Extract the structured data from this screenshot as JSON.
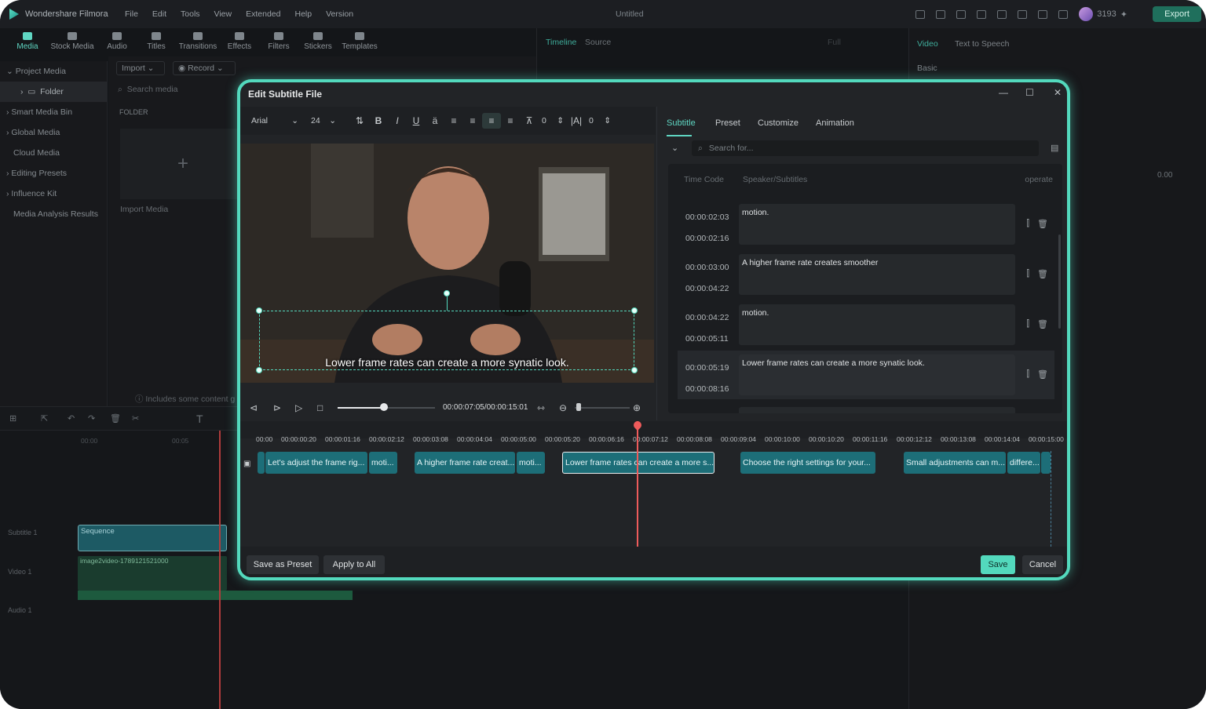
{
  "app": {
    "name": "Wondershare Filmora",
    "project_title": "Untitled",
    "menu": [
      "File",
      "Edit",
      "Tools",
      "View",
      "Extended",
      "Help",
      "Version"
    ],
    "credits": "3193",
    "export_label": "Export"
  },
  "toolbar": [
    "Media",
    "Stock Media",
    "Audio",
    "Titles",
    "Transitions",
    "Effects",
    "Filters",
    "Stickers",
    "Templates"
  ],
  "left_nav": [
    "Project Media",
    "Folder",
    "Smart Media Bin",
    "Global Media",
    "Cloud Media",
    "Editing Presets",
    "Influence Kit",
    "Media Analysis Results"
  ],
  "media": {
    "import": "Import",
    "record": "Record",
    "search_placeholder": "Search media",
    "folder_header": "FOLDER",
    "import_media": "Import Media",
    "note": "Includes some content g"
  },
  "player_tabs": {
    "timeline": "Timeline",
    "source": "Source",
    "quality": "Full"
  },
  "right_panel": {
    "tabs": [
      "Video",
      "Text to Speech"
    ],
    "section": "Basic",
    "value": "0.00"
  },
  "timeline": {
    "ruler": [
      "00:00",
      "00:05"
    ],
    "tracks": [
      "Subtitle 1",
      "Video 1",
      "Audio 1"
    ],
    "sequence_clip": "Sequence",
    "video_clip": "image2video-1789121521000"
  },
  "dialog": {
    "title": "Edit Subtitle File",
    "font": "Arial",
    "size": "24",
    "spacing": "0",
    "line_spacing": "0",
    "preview_subtitle": "Lower frame rates can create a more synatic look.",
    "timecode": "00:00:07:05/00:00:15:01",
    "tabs": [
      "Subtitle",
      "Preset",
      "Customize",
      "Animation"
    ],
    "search_placeholder": "Search for...",
    "columns": {
      "time": "Time Code",
      "speaker": "Speaker/Subtitles",
      "operate": "operate"
    },
    "rows": [
      {
        "start": "00:00:02:03",
        "end": "00:00:02:16",
        "text": "motion."
      },
      {
        "start": "00:00:03:00",
        "end": "00:00:04:22",
        "text": "A higher frame rate creates smoother"
      },
      {
        "start": "00:00:04:22",
        "end": "00:00:05:11",
        "text": "motion."
      },
      {
        "start": "00:00:05:19",
        "end": "00:00:08:16",
        "text": "Lower frame rates can create a more synatic look."
      }
    ],
    "ruler": [
      "00:00",
      "00:00:00:20",
      "00:00:01:16",
      "00:00:02:12",
      "00:00:03:08",
      "00:00:04:04",
      "00:00:05:00",
      "00:00:05:20",
      "00:00:06:16",
      "00:00:07:12",
      "00:00:08:08",
      "00:00:09:04",
      "00:00:10:00",
      "00:00:10:20",
      "00:00:11:16",
      "00:00:12:12",
      "00:00:13:08",
      "00:00:14:04",
      "00:00:15:00"
    ],
    "clips": [
      "Let's adjust the frame rig...",
      "moti...",
      "A higher frame rate creat...",
      "moti...",
      "Lower frame rates can create a more s...",
      "Choose the right settings for your...",
      "Small adjustments can m...",
      "differe..."
    ],
    "buttons": {
      "save_preset": "Save as Preset",
      "apply_all": "Apply to All",
      "save": "Save",
      "cancel": "Cancel"
    }
  }
}
